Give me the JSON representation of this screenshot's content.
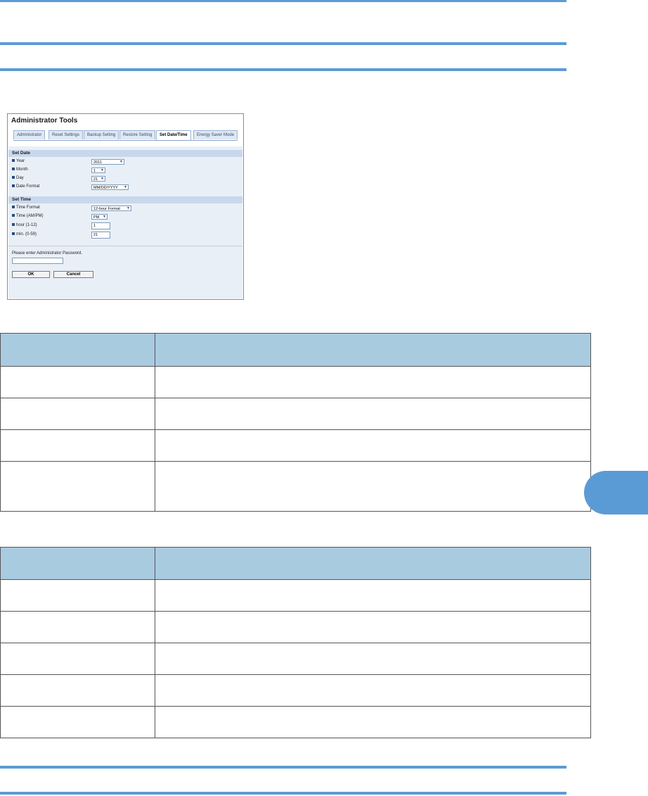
{
  "panel": {
    "title": "Administrator Tools",
    "tabs": [
      {
        "label": "Administrator"
      },
      {
        "label": "Reset Settings"
      },
      {
        "label": "Backup Setting"
      },
      {
        "label": "Restore Setting"
      },
      {
        "label": "Set Date/Time"
      },
      {
        "label": "Energy Saver Mode"
      }
    ],
    "set_date": {
      "heading": "Set Date",
      "year_label": "Year",
      "year_value": "2011",
      "month_label": "Month",
      "month_value": "1",
      "day_label": "Day",
      "day_value": "21",
      "date_format_label": "Date Format",
      "date_format_value": "MM/DD/YYYY"
    },
    "set_time": {
      "heading": "Set Time",
      "time_format_label": "Time Format",
      "time_format_value": "12-hour Format",
      "ampm_label": "Time (AM/PM)",
      "ampm_value": "PM",
      "hour_label": "hour (1-12)",
      "hour_value": "1",
      "min_label": "min. (0-59)",
      "min_value": "21"
    },
    "password_prompt": "Please enter Administrator Password.",
    "ok_label": "OK",
    "cancel_label": "Cancel"
  },
  "icons": {
    "dropdown": "chevron-down-icon",
    "bullet": "square-bullet-icon"
  },
  "colors": {
    "rule": "#5b9bd5",
    "table_header": "#a9cbe0",
    "thumb_tab": "#5b9bd5"
  }
}
